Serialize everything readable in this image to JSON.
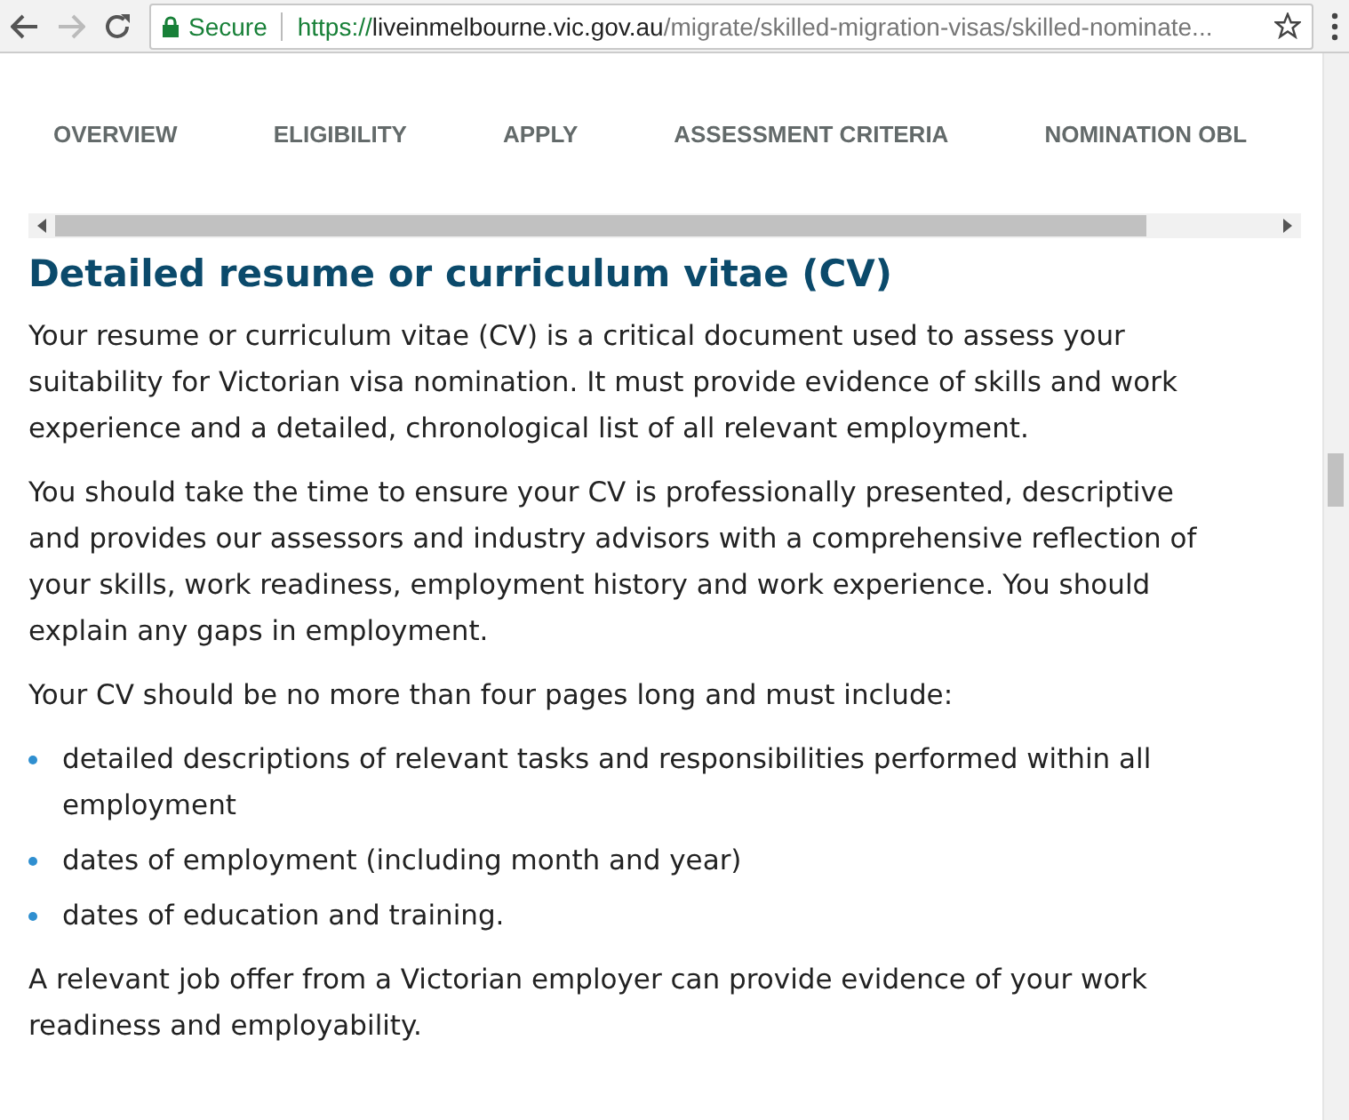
{
  "browser": {
    "security_label": "Secure",
    "url": {
      "scheme": "https://",
      "host": "liveinmelbourne.vic.gov.au",
      "path": "/migrate/skilled-migration-visas/skilled-nominate..."
    }
  },
  "tabs": [
    {
      "label": "OVERVIEW"
    },
    {
      "label": "ELIGIBILITY"
    },
    {
      "label": "APPLY"
    },
    {
      "label": "ASSESSMENT CRITERIA"
    },
    {
      "label": "NOMINATION OBL"
    }
  ],
  "article": {
    "heading": "Detailed resume or curriculum vitae (CV)",
    "paragraphs": [
      "Your resume or curriculum vitae (CV) is a critical document used to assess your suitability for Victorian visa nomination. It must provide evidence of skills and work experience and a detailed, chronological list of all relevant employment.",
      "You should take the time to ensure your CV is professionally presented, descriptive and provides our assessors and industry advisors with a comprehensive reflection of your skills, work readiness, employment history and work experience. You should explain any gaps in employment.",
      "Your CV should be no more than four pages long and must include:"
    ],
    "bullets": [
      "detailed descriptions of relevant tasks and responsibilities performed within all employment",
      "dates of employment (including month and year)",
      "dates of education and training."
    ],
    "closing": "A relevant job offer from a Victorian employer can provide evidence of your work readiness and employability."
  }
}
